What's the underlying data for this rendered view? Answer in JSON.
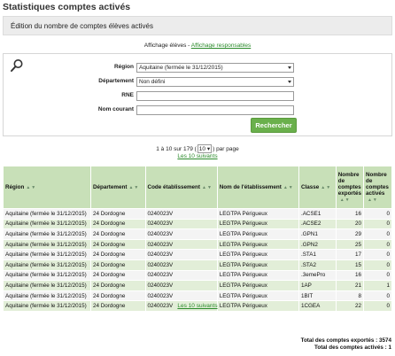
{
  "page": {
    "title": "Statistiques comptes activés",
    "subtitle": "Édition du nombre de comptes élèves activés"
  },
  "affichage": {
    "prefix": "Affichage élèves - ",
    "link": "Affichage responsables"
  },
  "filters": {
    "region_label": "Région",
    "region_value": "Aquitaine (fermée le 31/12/2015)",
    "departement_label": "Département",
    "departement_value": "Non défini",
    "rne_label": "RNE",
    "rne_value": "",
    "nom_label": "Nom courant",
    "nom_value": "",
    "search_button": "Rechercher"
  },
  "pager": {
    "prefix": "1 à 10 sur 179 (",
    "page_size": "10",
    "suffix": ") par page",
    "next": "Les 10 suivants"
  },
  "table": {
    "headers": [
      "Région",
      "Département",
      "Code établissement",
      "Nom de l'établissement",
      "Classe",
      "Nombre de comptes exportés",
      "Nombre de comptes activés"
    ],
    "rows": [
      [
        "Aquitaine (fermée le 31/12/2015)",
        "24 Dordogne",
        "0240023V",
        "LEGTPA Périgueux",
        ".ACSE1",
        "16",
        "0"
      ],
      [
        "Aquitaine (fermée le 31/12/2015)",
        "24 Dordogne",
        "0240023V",
        "LEGTPA Périgueux",
        ".ACSE2",
        "20",
        "0"
      ],
      [
        "Aquitaine (fermée le 31/12/2015)",
        "24 Dordogne",
        "0240023V",
        "LEGTPA Périgueux",
        ".GPN1",
        "29",
        "0"
      ],
      [
        "Aquitaine (fermée le 31/12/2015)",
        "24 Dordogne",
        "0240023V",
        "LEGTPA Périgueux",
        ".GPN2",
        "25",
        "0"
      ],
      [
        "Aquitaine (fermée le 31/12/2015)",
        "24 Dordogne",
        "0240023V",
        "LEGTPA Périgueux",
        ".STA1",
        "17",
        "0"
      ],
      [
        "Aquitaine (fermée le 31/12/2015)",
        "24 Dordogne",
        "0240023V",
        "LEGTPA Périgueux",
        ".STA2",
        "15",
        "0"
      ],
      [
        "Aquitaine (fermée le 31/12/2015)",
        "24 Dordogne",
        "0240023V",
        "LEGTPA Périgueux",
        ".3emePro",
        "16",
        "0"
      ],
      [
        "Aquitaine (fermée le 31/12/2015)",
        "24 Dordogne",
        "0240023V",
        "LEGTPA Périgueux",
        "1AP",
        "21",
        "1"
      ],
      [
        "Aquitaine (fermée le 31/12/2015)",
        "24 Dordogne",
        "0240023V",
        "LEGTPA Périgueux",
        "1BIT",
        "8",
        "0"
      ],
      [
        "Aquitaine (fermée le 31/12/2015)",
        "24 Dordogne",
        "0240023V",
        "LEGTPA Périgueux",
        "1CGEA",
        "22",
        "0"
      ]
    ]
  },
  "totals": {
    "exported": "Total des comptes exportés : 3574",
    "activated": "Total des comptes activés : 1"
  },
  "colors": {
    "accent": "#6ab04c",
    "link": "#2a8a2a",
    "header_bg": "#c8e0b8",
    "row_alt": "#e2eed8"
  }
}
